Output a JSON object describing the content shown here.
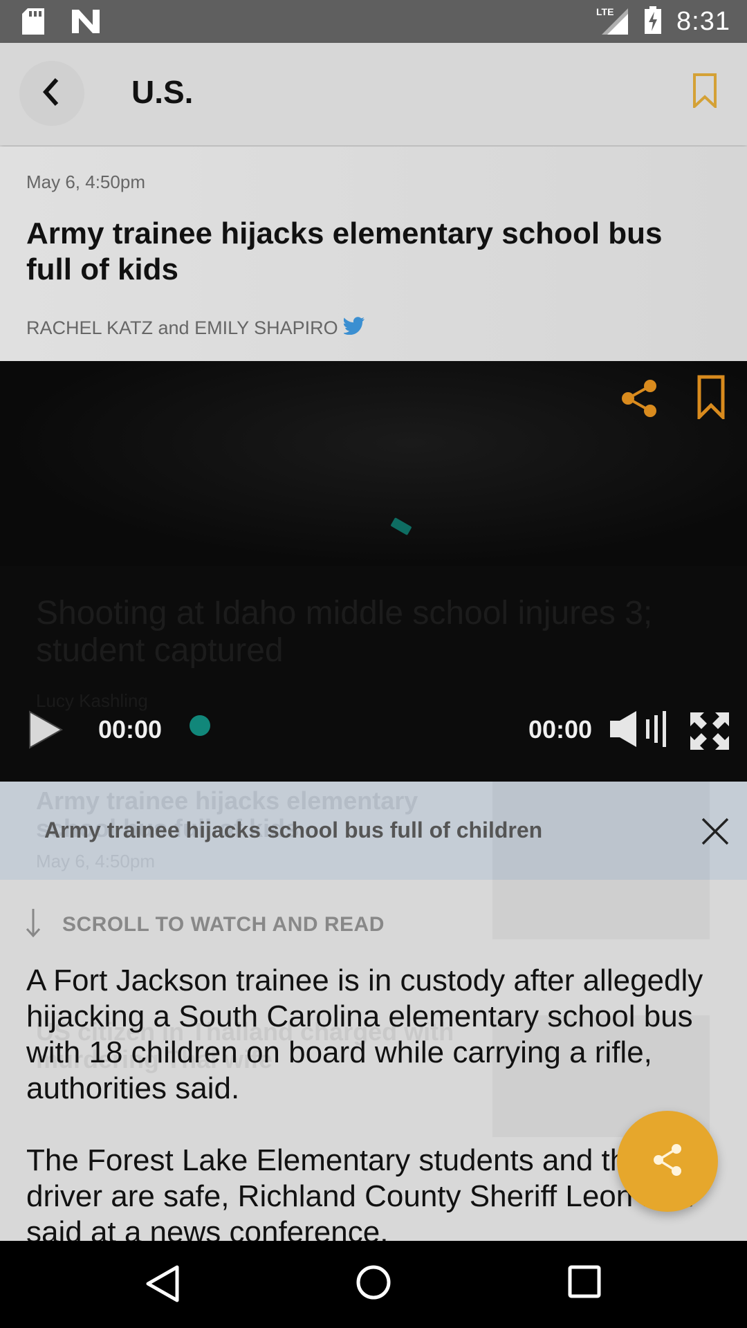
{
  "status_bar": {
    "time": "8:31",
    "network": "LTE",
    "icons": [
      "sd-card-icon",
      "n-icon",
      "signal-icon",
      "battery-charging-icon"
    ]
  },
  "header": {
    "title": "U.S.",
    "back_icon": "chevron-left-icon",
    "bookmark_icon": "bookmark-icon"
  },
  "article": {
    "date": "May 6, 4:50pm",
    "title": "Army trainee hijacks elementary school bus full of kids",
    "authors": "RACHEL KATZ and EMILY SHAPIRO",
    "author_icon": "twitter-icon"
  },
  "video": {
    "ghost_title": "Shooting at Idaho middle school injures 3; student captured",
    "ghost_byline": "Lucy Kashling",
    "current_time": "00:00",
    "total_time": "00:00",
    "icons": [
      "share-icon",
      "bookmark-icon",
      "play-icon",
      "volume-icon",
      "fullscreen-icon"
    ]
  },
  "info_bar": {
    "text": "Army trainee hijacks school bus full of children",
    "ghost_text": "Army trainee hijacks elementary school bus full of kids",
    "ghost_date": "May 6, 4:50pm"
  },
  "body": {
    "scroll_label": "SCROLL TO WATCH AND READ",
    "ghost_headline": "US citizen in Thailand charged with murdering Thai wife",
    "paragraphs": [
      "A Fort Jackson trainee is in custody after allegedly hijacking a South Carolina elementary school bus with 18 children on board while carrying a rifle, authorities said.",
      "The Forest Lake Elementary students and the bus driver are safe, Richland County Sheriff Leon Lott said at a news conference."
    ]
  },
  "colors": {
    "accent": "#e6a72c",
    "bookmark": "#d4a136",
    "progress": "#11877a",
    "twitter": "#3b8fd1"
  }
}
